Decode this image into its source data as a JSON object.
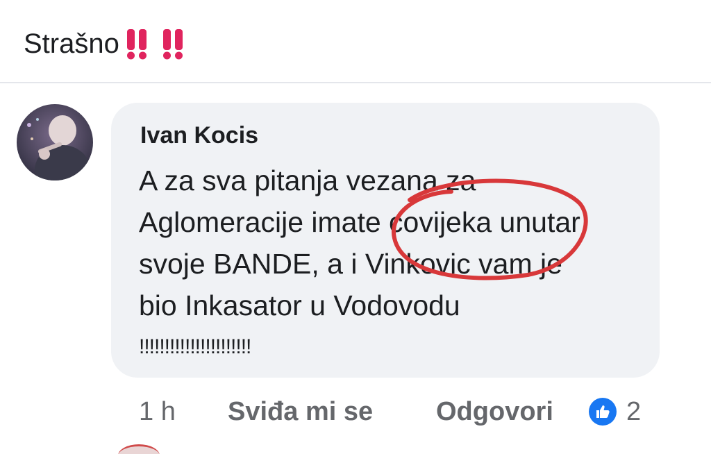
{
  "post": {
    "text": "Strašno",
    "emoji_icon": "double-exclamation-icon",
    "emoji_color": "#e0245e"
  },
  "comment": {
    "author": "Ivan Kocis",
    "lines": [
      "A za sva pitanja vezana za",
      "Aglomeracije imate covijeka unutar",
      "svoje BANDE, a i Vinkovic vam je",
      "bio Inkasator u Vodovodu",
      "!!!!!!!!!!!!!!!!!!!!!!"
    ],
    "time": "1 h",
    "like_label": "Sviđa mi se",
    "reply_label": "Odgovori",
    "reaction_icon": "like-icon",
    "reaction_count": "2",
    "highlight_color": "#d8383a",
    "reaction_color": "#1877f2"
  }
}
